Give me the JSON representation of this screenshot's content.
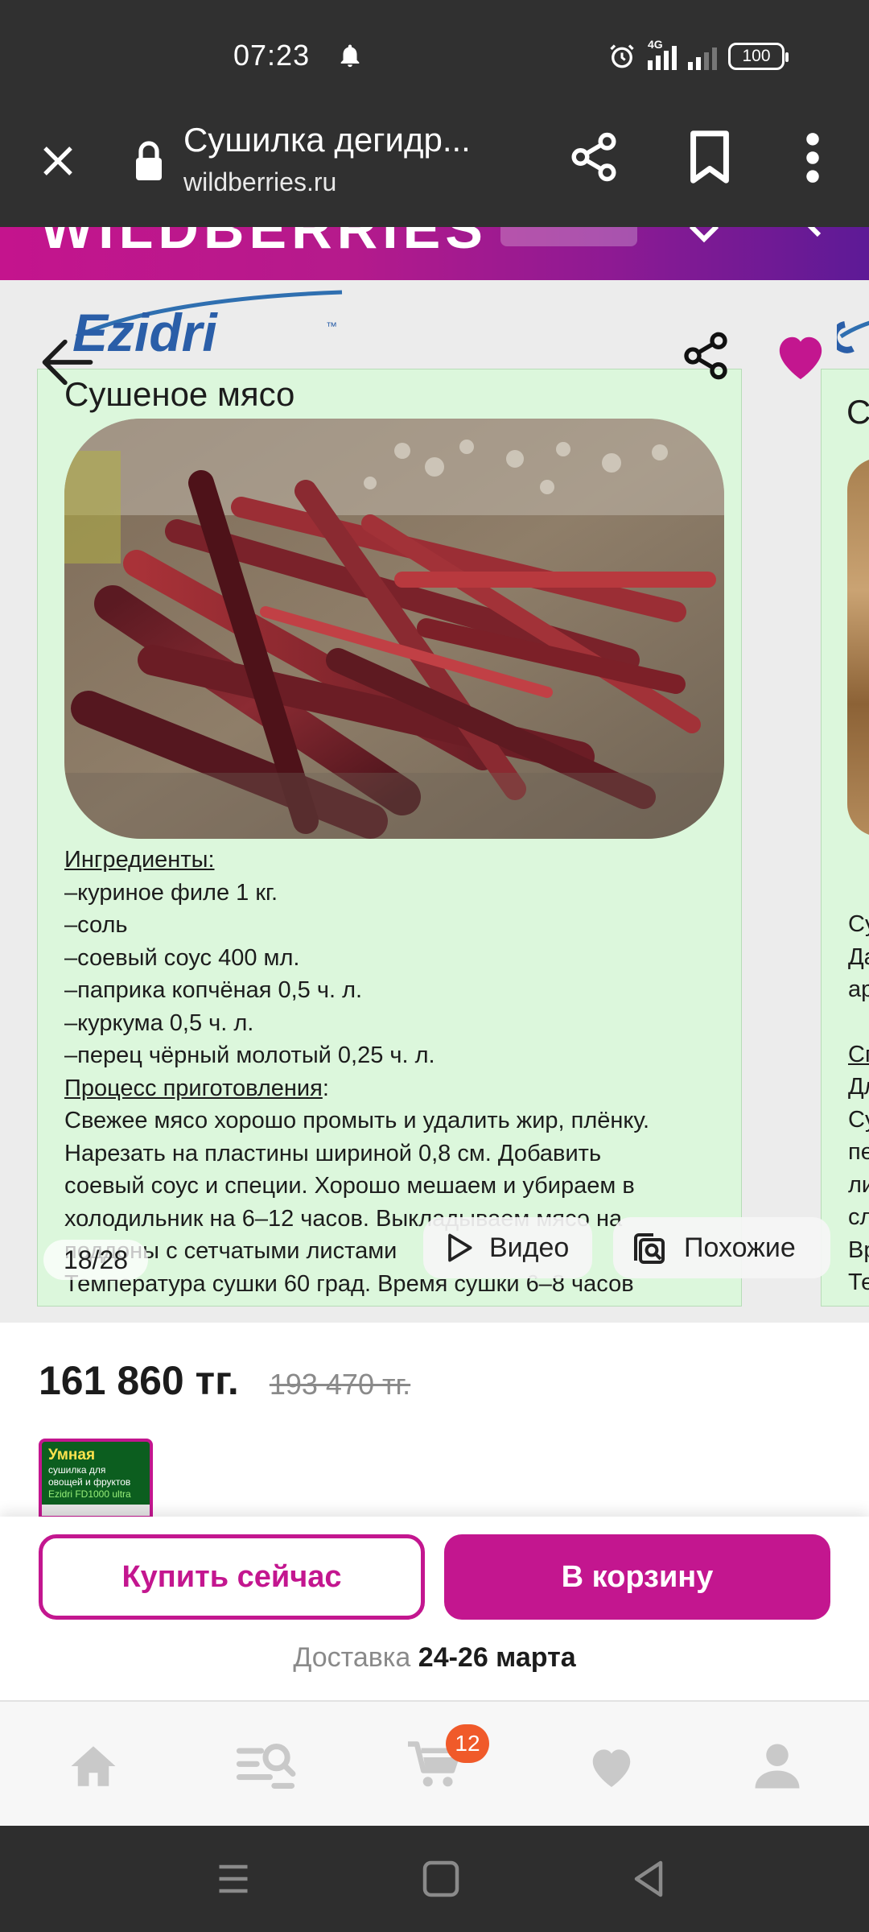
{
  "status_bar": {
    "time": "07:23",
    "network": "4G",
    "battery": "100"
  },
  "browser": {
    "title": "Сушилка дегидр...",
    "url": "wildberries.ru"
  },
  "wb_header": {
    "logo_text": "WILDBERRIES"
  },
  "gallery": {
    "brand": "Ezidri",
    "brand_tm": "™",
    "slide_title": "Сушеное мясо",
    "ingredients_heading": "Ингредиенты:",
    "ingredients": [
      "–куриное филе 1 кг.",
      "–соль",
      "–соевый соус 400 мл.",
      "–паприка копчёная 0,5 ч. л.",
      "–куркума 0,5 ч. л.",
      "–перец чёрный молотый 0,25 ч. л."
    ],
    "process_heading": "Процесс приготовления",
    "process_colon": ":",
    "process_lines": [
      "Свежее мясо хорошо промыть и удалить жир, плёнку.",
      "Нарезать на пластины шириной 0,8 см. Добавить",
      "соевый соус и специи. Хорошо мешаем и убираем в",
      "холодильник на 6–12 часов. Выкладываем мясо на",
      "поддоны с сетчатыми листами",
      "Температура сушки   60 град. Время сушки   6–8 часов"
    ],
    "next_slide_peek": {
      "title": "С",
      "lines": [
        "Су",
        "Да",
        "ар",
        "",
        "Сп",
        "Дл",
        "Су",
        "пе",
        "ли",
        "сл",
        "Вр",
        "Те"
      ]
    },
    "counter": "18/28",
    "video_label": "Видео",
    "similar_label": "Похожие"
  },
  "price": {
    "current": "161 860 тг.",
    "old": "193 470 тг."
  },
  "variant_thumb": {
    "line1": "Умная",
    "line2": "сушилка для",
    "line3": "овощей и фруктов",
    "line4": "Ezidri FD1000 ultra"
  },
  "actions": {
    "buy_now": "Купить сейчас",
    "add_to_cart": "В корзину",
    "delivery_label": "Доставка",
    "delivery_date": "24-26 марта"
  },
  "bottom_nav": {
    "cart_count": "12"
  },
  "colors": {
    "brand": "#c3168f",
    "badge": "#f05a2a",
    "slide_bg": "#dcf7dc"
  }
}
